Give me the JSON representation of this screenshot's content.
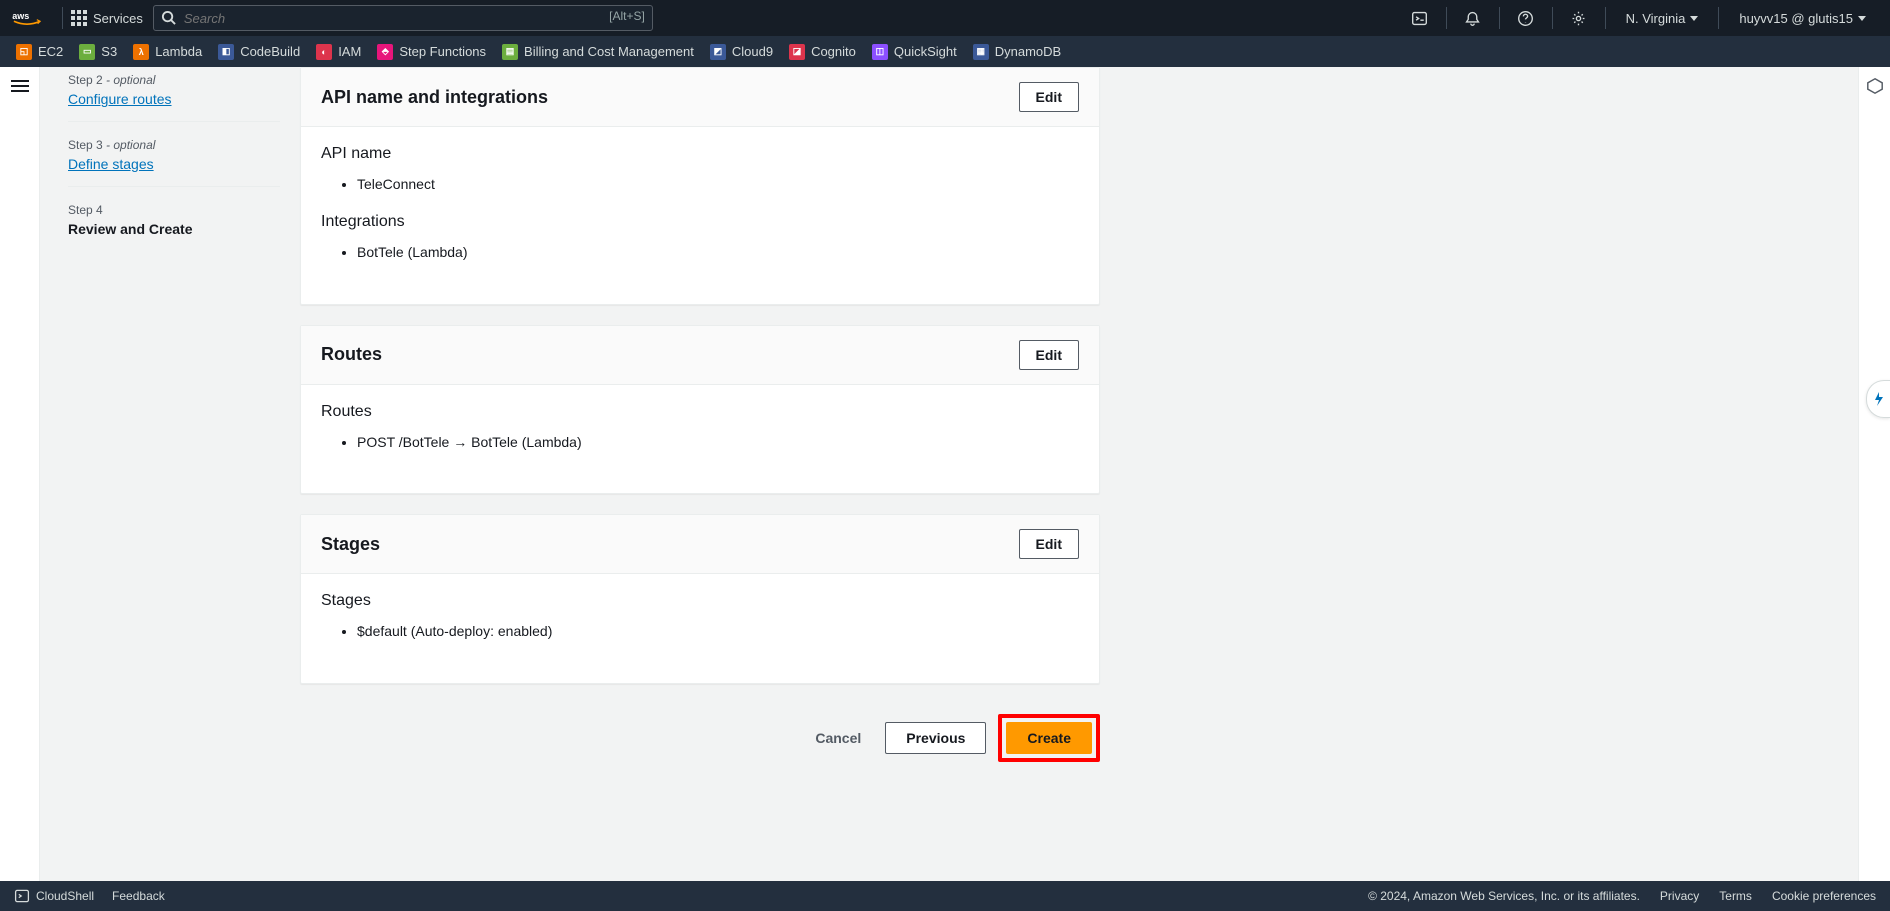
{
  "topnav": {
    "services": "Services",
    "search_placeholder": "Search",
    "search_kbd": "[Alt+S]",
    "region": "N. Virginia",
    "account": "huyvv15 @ glutis15"
  },
  "favorites": [
    {
      "label": "EC2"
    },
    {
      "label": "S3"
    },
    {
      "label": "Lambda"
    },
    {
      "label": "CodeBuild"
    },
    {
      "label": "IAM"
    },
    {
      "label": "Step Functions"
    },
    {
      "label": "Billing and Cost Management"
    },
    {
      "label": "Cloud9"
    },
    {
      "label": "Cognito"
    },
    {
      "label": "QuickSight"
    },
    {
      "label": "DynamoDB"
    }
  ],
  "wizard": {
    "step2_label": "Step 2",
    "step2_opt": "- optional",
    "step2_link": "Configure routes",
    "step3_label": "Step 3",
    "step3_opt": "- optional",
    "step3_link": "Define stages",
    "step4_label": "Step 4",
    "step4_title": "Review and Create"
  },
  "edit_label": "Edit",
  "panel1": {
    "title": "API name and integrations",
    "api_name_label": "API name",
    "api_name_value": "TeleConnect",
    "integrations_label": "Integrations",
    "integrations_value": "BotTele (Lambda)"
  },
  "panel2": {
    "title": "Routes",
    "routes_label": "Routes",
    "routes_value": "POST /BotTele → BotTele (Lambda)"
  },
  "panel3": {
    "title": "Stages",
    "stages_label": "Stages",
    "stages_value": "$default (Auto-deploy: enabled)"
  },
  "actions": {
    "cancel": "Cancel",
    "previous": "Previous",
    "create": "Create"
  },
  "footer": {
    "cloudshell": "CloudShell",
    "feedback": "Feedback",
    "copyright": "© 2024, Amazon Web Services, Inc. or its affiliates.",
    "privacy": "Privacy",
    "terms": "Terms",
    "cookies": "Cookie preferences"
  }
}
